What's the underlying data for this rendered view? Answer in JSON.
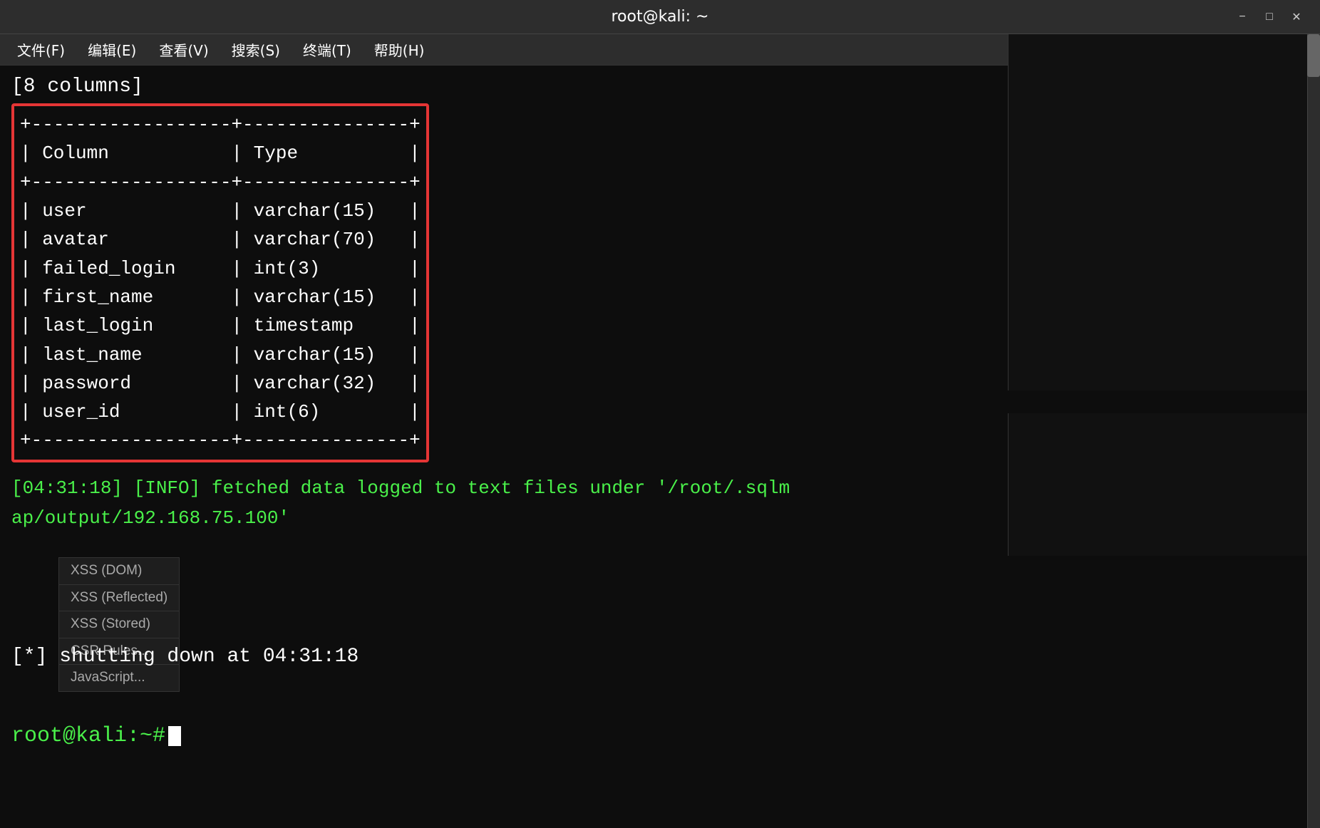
{
  "window": {
    "title": "root@kali: ~",
    "minimize_label": "−",
    "maximize_label": "□",
    "close_label": "✕"
  },
  "menubar": {
    "items": [
      {
        "label": "文件(F)"
      },
      {
        "label": "编辑(E)"
      },
      {
        "label": "查看(V)"
      },
      {
        "label": "搜索(S)"
      },
      {
        "label": "终端(T)"
      },
      {
        "label": "帮助(H)"
      }
    ]
  },
  "terminal": {
    "columns_line": "[8 columns]",
    "table": {
      "border_top": "+------------------+---------------+",
      "header_row": "| Column           | Type          |",
      "border_mid": "+------------------+---------------+",
      "rows": [
        "| user             | varchar(15)   |",
        "| avatar           | varchar(70)   |",
        "| failed_login     | int(3)        |",
        "| first_name       | varchar(15)   |",
        "| last_login       | timestamp     |",
        "| last_name        | varchar(15)   |",
        "| password         | varchar(32)   |",
        "| user_id          | int(6)        |"
      ],
      "border_bot": "+------------------+---------------+"
    },
    "info_line1": "[04:31:18] [INFO] fetched data logged to text files under '/root/.sqlm",
    "info_line2": "ap/output/192.168.75.100'",
    "shutdown_line": "[*] shutting down at 04:31:18",
    "prompt": "root@kali:~# "
  },
  "side_menu": {
    "items": [
      {
        "label": "XSS (DOM)"
      },
      {
        "label": "XSS (Reflected)"
      },
      {
        "label": "XSS (Stored)"
      },
      {
        "label": "CSR Rules..."
      },
      {
        "label": "JavaScript..."
      }
    ]
  },
  "colors": {
    "terminal_bg": "#0d0d0d",
    "green_text": "#4af04a",
    "white_text": "#ffffff",
    "red_border": "#e53535",
    "titlebar_bg": "#2d2d2d"
  }
}
